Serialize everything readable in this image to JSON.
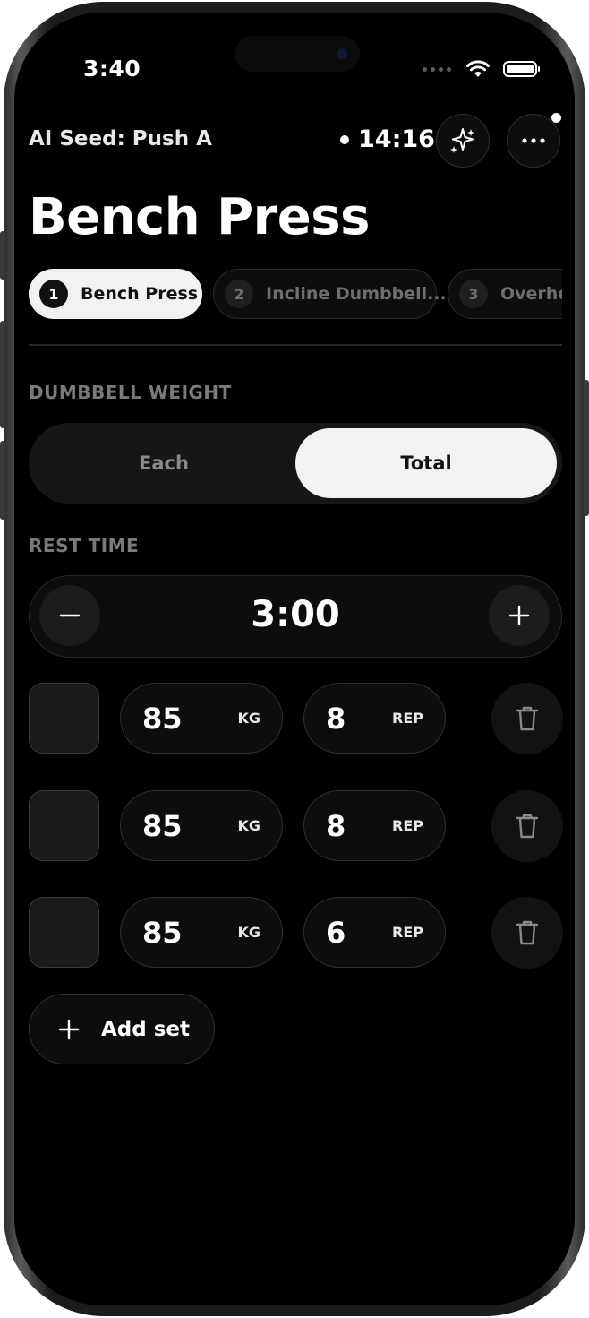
{
  "status_bar": {
    "time": "3:40"
  },
  "header": {
    "workout_name": "AI Seed: Push A",
    "elapsed": "14:16",
    "ai_icon": "sparkles-icon",
    "more_icon": "ellipsis-icon"
  },
  "exercise": {
    "title": "Bench Press"
  },
  "exercise_tabs": [
    {
      "number": "1",
      "label": "Bench Press",
      "active": true
    },
    {
      "number": "2",
      "label": "Incline Dumbbell...",
      "active": false
    },
    {
      "number": "3",
      "label": "Overhe",
      "active": false
    }
  ],
  "dumbbell_weight": {
    "label": "DUMBBELL WEIGHT",
    "options": [
      "Each",
      "Total"
    ],
    "selected": "Total"
  },
  "rest_time": {
    "label": "REST TIME",
    "value": "3:00"
  },
  "sets": [
    {
      "weight": "85",
      "weight_unit": "KG",
      "reps": "8",
      "reps_unit": "REP"
    },
    {
      "weight": "85",
      "weight_unit": "KG",
      "reps": "8",
      "reps_unit": "REP"
    },
    {
      "weight": "85",
      "weight_unit": "KG",
      "reps": "6",
      "reps_unit": "REP"
    }
  ],
  "add_set": {
    "label": "Add set"
  },
  "colors": {
    "background": "#000000",
    "active_pill": "#f2f2f2",
    "muted_text": "#7a7a7a"
  }
}
